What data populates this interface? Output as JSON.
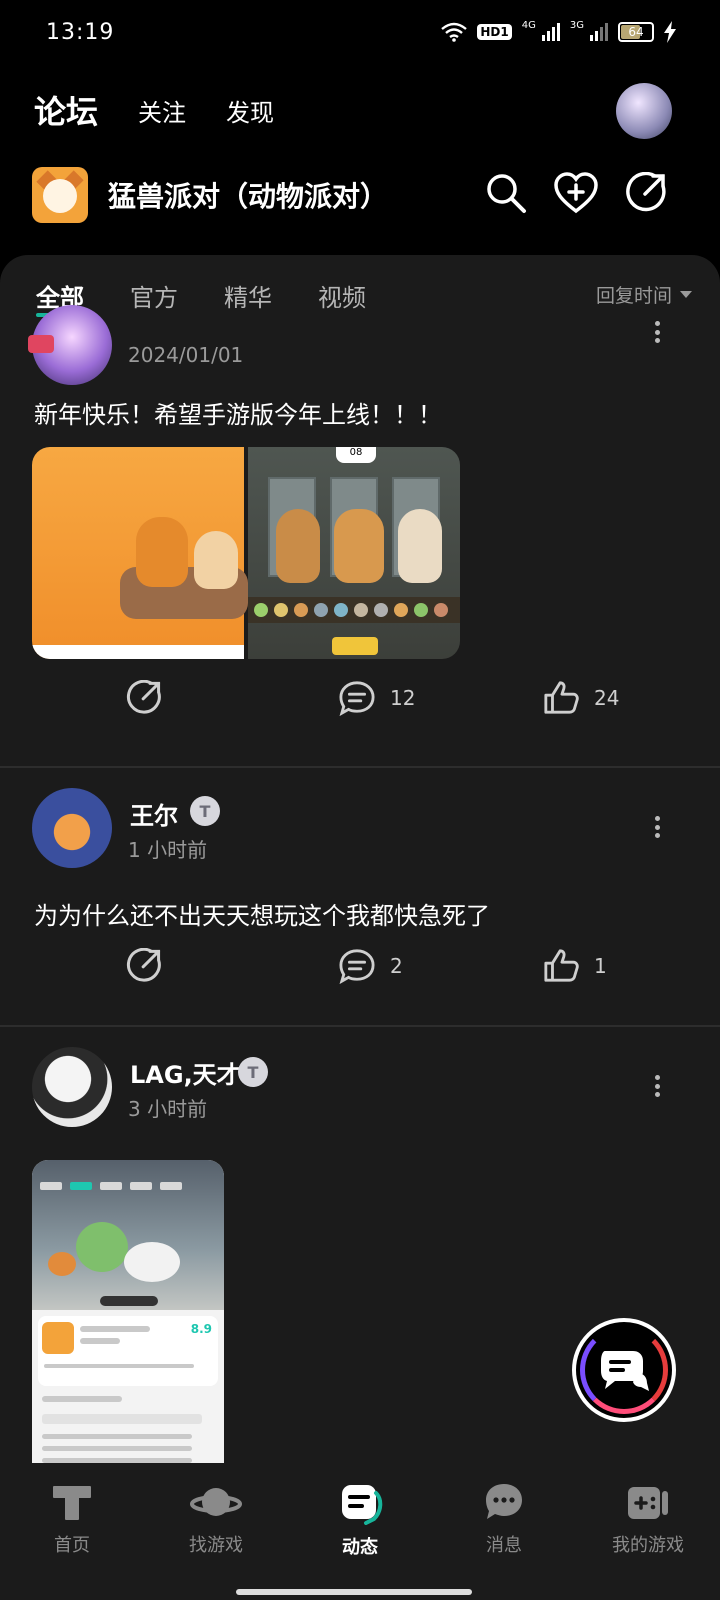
{
  "status_bar": {
    "time": "13:19",
    "hd_label": "HD1",
    "net1": "4G",
    "net2": "3G",
    "battery": "64",
    "battery_level": 0.64,
    "icons": [
      "wifi-icon",
      "signal-icon",
      "battery-icon",
      "charging-icon"
    ]
  },
  "top_nav": {
    "tabs": [
      {
        "label": "论坛",
        "active": true
      },
      {
        "label": "关注",
        "active": false
      },
      {
        "label": "发现",
        "active": false
      }
    ]
  },
  "game": {
    "title": "猛兽派对（动物派对）",
    "actions": [
      "search-icon",
      "add-follow-icon",
      "share-icon"
    ]
  },
  "filter": {
    "tabs": [
      {
        "label": "全部",
        "active": true
      },
      {
        "label": "官方",
        "active": false
      },
      {
        "label": "精华",
        "active": false
      },
      {
        "label": "视频",
        "active": false
      }
    ],
    "sort_label": "回复时间"
  },
  "posts": [
    {
      "date": "2024/01/01",
      "text": "新年快乐！希望手游版今年上线！！！",
      "timer_label": "08",
      "comments": "12",
      "likes": "24"
    },
    {
      "name": "王尔",
      "badge": "T",
      "date": "1 小时前",
      "text": "为为什么还不出天天想玩这个我都快急死了",
      "comments": "2",
      "likes": "1"
    },
    {
      "name": "LAG,天才",
      "badge": "T",
      "date": "3 小时前",
      "shot_score": "8.9"
    }
  ],
  "bottom_nav": [
    {
      "label": "首页",
      "icon": "home-icon",
      "active": false
    },
    {
      "label": "找游戏",
      "icon": "planet-icon",
      "active": false
    },
    {
      "label": "动态",
      "icon": "feed-icon",
      "active": true
    },
    {
      "label": "消息",
      "icon": "message-icon",
      "active": false
    },
    {
      "label": "我的游戏",
      "icon": "gamepad-icon",
      "active": false
    }
  ],
  "colors": {
    "accent": "#17b59b",
    "background": "#000000",
    "sheet": "#1b1b1b"
  }
}
